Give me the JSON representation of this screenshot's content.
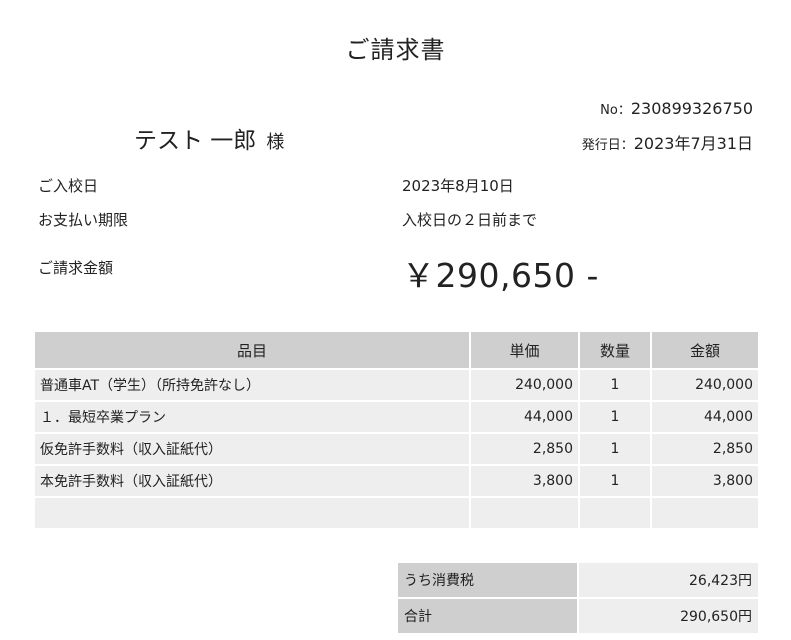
{
  "document": {
    "title": "ご請求書",
    "customer_name": "テスト 一郎",
    "honorific": "様",
    "no_label": "No：",
    "no_value": "230899326750",
    "issue_label": "発行日：",
    "issue_value": "2023年7月31日"
  },
  "info": {
    "admission_label": "ご入校日",
    "admission_value": "2023年8月10日",
    "deadline_label": "お支払い期限",
    "deadline_value": "入校日の２日前まで",
    "amount_label": "ご請求金額",
    "amount_value": "￥290,650 -"
  },
  "table": {
    "headers": {
      "item": "品目",
      "unit_price": "単価",
      "qty": "数量",
      "amount": "金額"
    },
    "rows": [
      {
        "item": "普通車AT（学生）（所持免許なし）",
        "unit_price": "240,000",
        "qty": "1",
        "amount": "240,000"
      },
      {
        "item": "１．最短卒業プラン",
        "unit_price": "44,000",
        "qty": "1",
        "amount": "44,000"
      },
      {
        "item": "仮免許手数料（収入証紙代）",
        "unit_price": "2,850",
        "qty": "1",
        "amount": "2,850"
      },
      {
        "item": "本免許手数料（収入証紙代）",
        "unit_price": "3,800",
        "qty": "1",
        "amount": "3,800"
      },
      {
        "item": "",
        "unit_price": "",
        "qty": "",
        "amount": ""
      }
    ]
  },
  "totals": {
    "tax_label": "うち消費税",
    "tax_value": "26,423円",
    "total_label": "合計",
    "total_value": "290,650円"
  }
}
